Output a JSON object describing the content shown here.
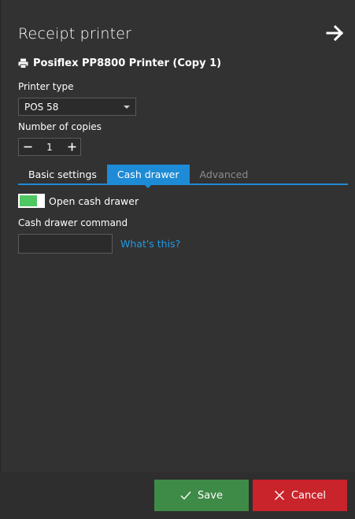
{
  "header": {
    "title": "Receipt printer",
    "printer_name": "Posiflex PP8800 Printer (Copy 1)"
  },
  "form": {
    "printer_type_label": "Printer type",
    "printer_type_value": "POS 58",
    "copies_label": "Number of copies",
    "copies_value": "1"
  },
  "tabs": [
    {
      "label": "Basic settings",
      "state": "normal"
    },
    {
      "label": "Cash drawer",
      "state": "active"
    },
    {
      "label": "Advanced",
      "state": "disabled"
    }
  ],
  "cash_drawer": {
    "toggle_label": "Open cash drawer",
    "toggle_on": true,
    "command_label": "Cash drawer command",
    "command_value": "",
    "help_link": "What's this?"
  },
  "footer": {
    "save_label": "Save",
    "cancel_label": "Cancel"
  },
  "colors": {
    "accent": "#1e8bd6",
    "save": "#3e8a47",
    "cancel": "#c9242b",
    "toggle_on": "#4fc763",
    "link": "#1f9be6"
  },
  "icons": [
    "arrow-right-icon",
    "printer-icon",
    "minus-icon",
    "plus-icon",
    "chevron-down-icon",
    "check-icon",
    "close-icon"
  ]
}
